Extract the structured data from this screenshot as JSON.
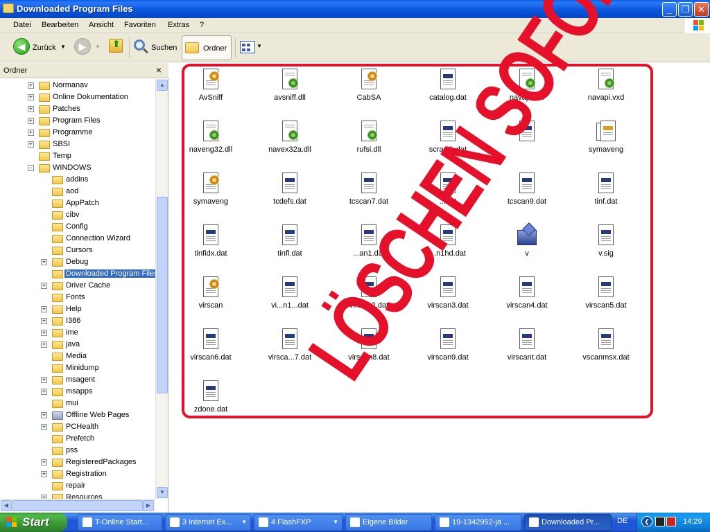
{
  "window": {
    "title": "Downloaded Program Files"
  },
  "menu": [
    "Datei",
    "Bearbeiten",
    "Ansicht",
    "Favoriten",
    "Extras",
    "?"
  ],
  "toolbar": {
    "back_label": "Zurück",
    "search_label": "Suchen",
    "folders_label": "Ordner"
  },
  "folder_pane": {
    "title": "Ordner",
    "close_glyph": "×",
    "tree": [
      {
        "label": "Normanav",
        "level": 0,
        "exp": "+"
      },
      {
        "label": "Online Dokumentation",
        "level": 0,
        "exp": "+"
      },
      {
        "label": "Patches",
        "level": 0,
        "exp": "+"
      },
      {
        "label": "Program Files",
        "level": 0,
        "exp": "+"
      },
      {
        "label": "Programme",
        "level": 0,
        "exp": "+"
      },
      {
        "label": "SBSI",
        "level": 0,
        "exp": "+"
      },
      {
        "label": "Temp",
        "level": 0,
        "exp": ""
      },
      {
        "label": "WINDOWS",
        "level": 0,
        "exp": "-"
      },
      {
        "label": "addins",
        "level": 1,
        "exp": ""
      },
      {
        "label": "aod",
        "level": 1,
        "exp": ""
      },
      {
        "label": "AppPatch",
        "level": 1,
        "exp": ""
      },
      {
        "label": "cibv",
        "level": 1,
        "exp": ""
      },
      {
        "label": "Config",
        "level": 1,
        "exp": ""
      },
      {
        "label": "Connection Wizard",
        "level": 1,
        "exp": ""
      },
      {
        "label": "Cursors",
        "level": 1,
        "exp": ""
      },
      {
        "label": "Debug",
        "level": 1,
        "exp": "+"
      },
      {
        "label": "Downloaded Program Files",
        "level": 1,
        "exp": "",
        "selected": true
      },
      {
        "label": "Driver Cache",
        "level": 1,
        "exp": "+"
      },
      {
        "label": "Fonts",
        "level": 1,
        "exp": ""
      },
      {
        "label": "Help",
        "level": 1,
        "exp": "+"
      },
      {
        "label": "I386",
        "level": 1,
        "exp": "+"
      },
      {
        "label": "ime",
        "level": 1,
        "exp": "+"
      },
      {
        "label": "java",
        "level": 1,
        "exp": "+"
      },
      {
        "label": "Media",
        "level": 1,
        "exp": ""
      },
      {
        "label": "Minidump",
        "level": 1,
        "exp": ""
      },
      {
        "label": "msagent",
        "level": 1,
        "exp": "+"
      },
      {
        "label": "msapps",
        "level": 1,
        "exp": "+"
      },
      {
        "label": "mui",
        "level": 1,
        "exp": ""
      },
      {
        "label": "Offline Web Pages",
        "level": 1,
        "exp": "+",
        "icon": "gear"
      },
      {
        "label": "PCHealth",
        "level": 1,
        "exp": "+"
      },
      {
        "label": "Prefetch",
        "level": 1,
        "exp": ""
      },
      {
        "label": "pss",
        "level": 1,
        "exp": ""
      },
      {
        "label": "RegisteredPackages",
        "level": 1,
        "exp": "+"
      },
      {
        "label": "Registration",
        "level": 1,
        "exp": "+"
      },
      {
        "label": "repair",
        "level": 1,
        "exp": ""
      },
      {
        "label": "Resources",
        "level": 1,
        "exp": "+"
      }
    ]
  },
  "files": [
    {
      "name": "AvSniff",
      "icon": "exe"
    },
    {
      "name": "avsniff.dll",
      "icon": "dll"
    },
    {
      "name": "CabSA",
      "icon": "exe"
    },
    {
      "name": "catalog.dat",
      "icon": "dat"
    },
    {
      "name": "navap...dll",
      "icon": "dll"
    },
    {
      "name": "navapi.vxd",
      "icon": "dll"
    },
    {
      "name": "naveng32.dll",
      "icon": "dll"
    },
    {
      "name": "navex32a.dll",
      "icon": "dll"
    },
    {
      "name": "rufsi.dll",
      "icon": "dll"
    },
    {
      "name": "scrauth.dat",
      "icon": "dat"
    },
    {
      "name": "",
      "icon": "dat"
    },
    {
      "name": "symaveng",
      "icon": "stack"
    },
    {
      "name": "symaveng",
      "icon": "exe"
    },
    {
      "name": "tcdefs.dat",
      "icon": "dat"
    },
    {
      "name": "tcscan7.dat",
      "icon": "dat"
    },
    {
      "name": "...dat",
      "icon": "dat"
    },
    {
      "name": "tcscan9.dat",
      "icon": "dat"
    },
    {
      "name": "tinf.dat",
      "icon": "dat"
    },
    {
      "name": "tinfidx.dat",
      "icon": "dat"
    },
    {
      "name": "tinfl.dat",
      "icon": "dat"
    },
    {
      "name": "...an1.dat",
      "icon": "dat"
    },
    {
      "name": "...n1hd.dat",
      "icon": "dat"
    },
    {
      "name": "v",
      "icon": "vlogo"
    },
    {
      "name": "v.sig",
      "icon": "dat"
    },
    {
      "name": "virscan",
      "icon": "exe"
    },
    {
      "name": "vi...n1...dat",
      "icon": "dat"
    },
    {
      "name": "virsc...2.dat",
      "icon": "dat"
    },
    {
      "name": "virscan3.dat",
      "icon": "dat"
    },
    {
      "name": "virscan4.dat",
      "icon": "dat"
    },
    {
      "name": "virscan5.dat",
      "icon": "dat"
    },
    {
      "name": "virscan6.dat",
      "icon": "dat"
    },
    {
      "name": "virsca...7.dat",
      "icon": "dat"
    },
    {
      "name": "virscan8.dat",
      "icon": "dat"
    },
    {
      "name": "virscan9.dat",
      "icon": "dat"
    },
    {
      "name": "virscant.dat",
      "icon": "dat"
    },
    {
      "name": "vscanmsx.dat",
      "icon": "dat"
    },
    {
      "name": "zdone.dat",
      "icon": "dat"
    }
  ],
  "overlay": {
    "text": "LÖSCHEN SOFORT",
    "color": "#e5102a"
  },
  "taskbar": {
    "start_label": "Start",
    "items": [
      {
        "label": "T-Online Start...",
        "dropdown": false
      },
      {
        "label": "3 Internet Ex...",
        "dropdown": true
      },
      {
        "label": "4 FlashFXP",
        "dropdown": true
      },
      {
        "label": "Eigene Bilder",
        "dropdown": false
      },
      {
        "label": "19-1342952-ja ...",
        "dropdown": false
      },
      {
        "label": "Downloaded Pr...",
        "dropdown": false,
        "active": true
      }
    ],
    "language": "DE",
    "clock": "14:29"
  }
}
